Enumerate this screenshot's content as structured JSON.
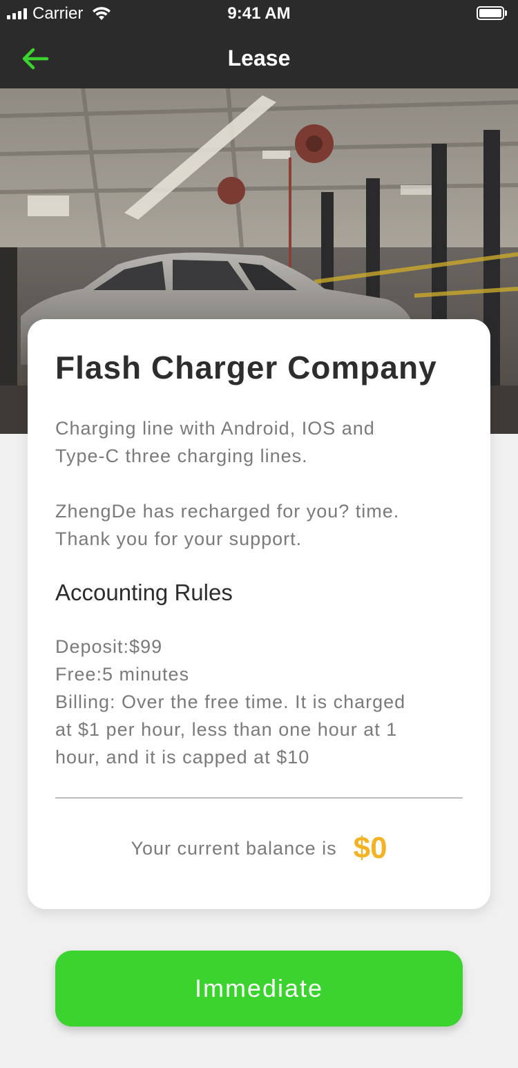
{
  "status_bar": {
    "carrier": "Carrier",
    "time": "9:41 AM"
  },
  "nav": {
    "title": "Lease",
    "back_icon": "arrow-left-icon",
    "accent_color": "#3bd42e"
  },
  "hero": {
    "image_description_icon": "car-garage-photo"
  },
  "card": {
    "company_name": "Flash Charger Company",
    "description_lines": [
      "Charging line with Android, IOS and",
      "Type-C three charging lines."
    ],
    "thanks_lines": [
      "ZhengDe has recharged for you? time.",
      "Thank you for your support."
    ],
    "section_title": "Accounting Rules",
    "rules_lines": [
      "Deposit:$99",
      "Free:5 minutes",
      "Billing: Over the free time. It is charged",
      "at $1 per hour, less than one hour at 1",
      "hour, and it is capped at $10"
    ],
    "balance_label": "Your current balance is",
    "balance_value": "$0",
    "balance_color": "#f5b324"
  },
  "action": {
    "button_label": "Immediate",
    "button_color": "#3bd42e"
  }
}
